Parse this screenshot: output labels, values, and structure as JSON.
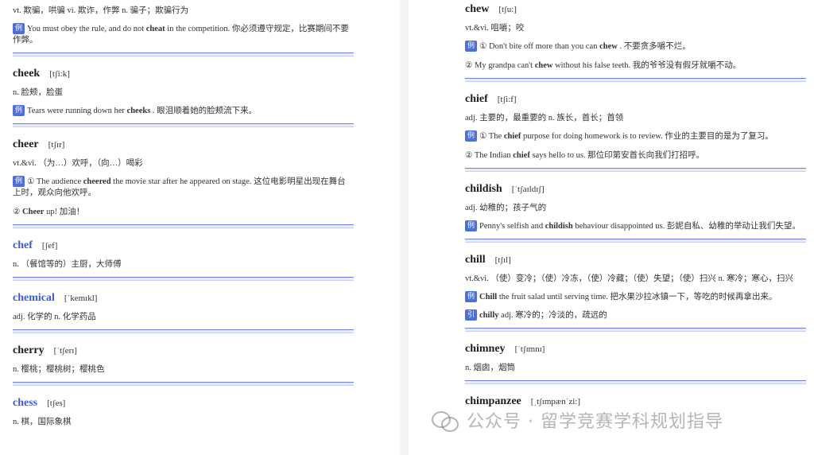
{
  "left": {
    "top_def": "vt. 欺骗，哄骗 vi. 欺诈，作弊 n. 骗子；欺骗行为",
    "top_example": {
      "tag": "例",
      "pre": "You must obey the rule, and do not ",
      "bold": "cheat",
      "post": " in the competition. 你必须遵守规定，比赛期间不要作弊。"
    },
    "entries": [
      {
        "word": "cheek",
        "phon": "[tʃi:k]",
        "def": "n. 脸颊，脸蛋",
        "ex1": {
          "tag": "例",
          "pre": "Tears were running down her ",
          "bold": "cheeks",
          "post": " . 眼泪顺着她的脸颊流下来。"
        }
      },
      {
        "word": "cheer",
        "phon": "[tʃɪr]",
        "def": "vt.&vi. （为…）欢呼，（向…）喝彩",
        "ex1": {
          "tag": "例",
          "pre": "① The audience ",
          "bold": "cheered",
          "post": " the movie star after he appeared on stage. 这位电影明星出现在舞台上时，观众向他欢呼。"
        },
        "ex2": {
          "pre": "② ",
          "bold": "Cheer",
          "post": " up! 加油！"
        }
      },
      {
        "word": "chef",
        "phon": "[ʃef]",
        "def": "n. （餐馆等的）主厨，大师傅"
      },
      {
        "word": "chemical",
        "phon": "[ˈkemɪkl]",
        "def": "adj. 化学的 n. 化学药品"
      },
      {
        "word": "cherry",
        "phon": "[ˈtʃerɪ]",
        "def": "n. 樱桃；樱桃树；樱桃色"
      },
      {
        "word": "chess",
        "phon": "[tʃes]",
        "def": "n. 棋，国际象棋"
      }
    ]
  },
  "right": {
    "entries": [
      {
        "word": "chew",
        "phon": "[tʃu:]",
        "def": "vt.&vi. 咀嚼；咬",
        "ex1": {
          "tag": "例",
          "pre": "① Don't bite off more than you can ",
          "bold": "chew",
          "post": " . 不要贪多嚼不烂。"
        },
        "ex2": {
          "pre": "② My grandpa can't ",
          "bold": "chew",
          "post": " without his false teeth. 我的爷爷没有假牙就嚼不动。"
        }
      },
      {
        "word": "chief",
        "phon": "[tʃi:f]",
        "def": "adj. 主要的，最重要的 n. 族长，首长；首领",
        "ex1": {
          "tag": "例",
          "pre": "① The ",
          "bold": "chief",
          "post": " purpose for doing homework is to review. 作业的主要目的是为了复习。"
        },
        "ex2": {
          "pre": "② The Indian ",
          "bold": "chief",
          "post": " says hello to us. 那位印第安首长向我们打招呼。"
        }
      },
      {
        "word": "childish",
        "phon": "[ˈtʃaɪldɪʃ]",
        "def": "adj. 幼稚的；孩子气的",
        "ex1": {
          "tag": "例",
          "pre": "Penny's selfish and ",
          "bold": "childish",
          "post": " behaviour disappointed us. 彭妮自私、幼稚的举动让我们失望。"
        }
      },
      {
        "word": "chill",
        "phon": "[tʃɪl]",
        "def": "vt.&vi. （使）变冷；（使）冷冻，（使）冷藏；（使）失望；（使）扫兴 n. 寒冷；寒心，扫兴",
        "ex1": {
          "tag": "例",
          "pre": "",
          "bold": "Chill",
          "post": " the fruit salad until serving time. 把水果沙拉冰镇一下，等吃的时候再拿出来。"
        },
        "ex2": {
          "tag": "引",
          "pre": "",
          "bold": "chilly",
          "post": " adj. 寒冷的；冷淡的，疏远的"
        }
      },
      {
        "word": "chimney",
        "phon": "[ˈtʃɪmnɪ]",
        "def": "n. 烟囱，烟筒"
      },
      {
        "word": "chimpanzee",
        "phon": "[ˌtʃɪmpænˈzi:]"
      }
    ]
  },
  "watermark": "公众号 · 留学竞赛学科规划指导",
  "colors": {
    "accent": "#4f6fd8",
    "link_word": "#3b5bd6",
    "separator": "#6d7fe0"
  }
}
